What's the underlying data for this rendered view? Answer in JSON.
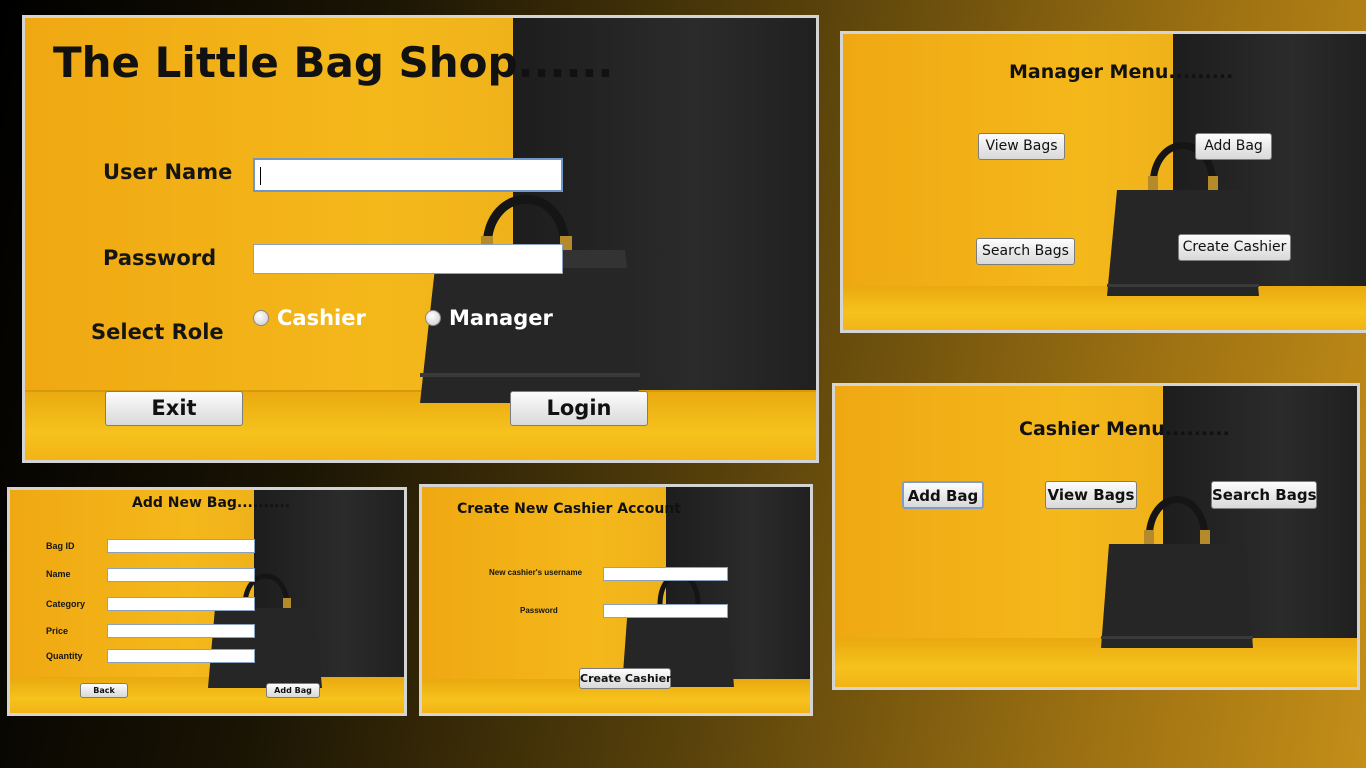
{
  "login": {
    "title": "The Little Bag Shop......",
    "username_label": "User Name",
    "password_label": "Password",
    "role_label": "Select Role",
    "role_options": [
      "Cashier",
      "Manager"
    ],
    "exit_button": "Exit",
    "login_button": "Login"
  },
  "manager_menu": {
    "title": "Manager Menu.........",
    "buttons": [
      "View Bags",
      "Add Bag",
      "Search Bags",
      "Create Cashier"
    ]
  },
  "cashier_menu": {
    "title": "Cashier Menu.........",
    "buttons": [
      "Add Bag",
      "View Bags",
      "Search Bags"
    ]
  },
  "add_bag": {
    "title": "Add New Bag..........",
    "fields": [
      "Bag ID",
      "Name",
      "Category",
      "Price",
      "Quantity"
    ],
    "back_button": "Back",
    "add_button": "Add Bag"
  },
  "create_cashier": {
    "title": "Create New Cashier Account",
    "username_label": "New cashier's username",
    "password_label": "Password",
    "create_button": "Create Cashier"
  }
}
